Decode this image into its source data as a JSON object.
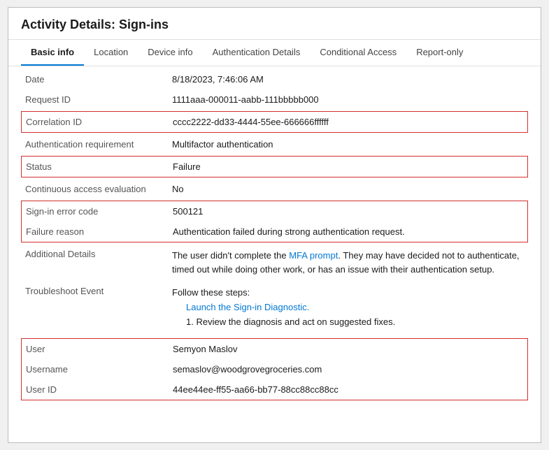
{
  "window": {
    "title": "Activity Details: Sign-ins"
  },
  "tabs": [
    {
      "label": "Basic info",
      "active": true
    },
    {
      "label": "Location",
      "active": false
    },
    {
      "label": "Device info",
      "active": false
    },
    {
      "label": "Authentication Details",
      "active": false
    },
    {
      "label": "Conditional Access",
      "active": false
    },
    {
      "label": "Report-only",
      "active": false
    }
  ],
  "rows": {
    "date_label": "Date",
    "date_value": "8/18/2023, 7:46:06 AM",
    "request_id_label": "Request ID",
    "request_id_value": "1111aaa-000011-aabb-111bbbbb000",
    "correlation_id_label": "Correlation ID",
    "correlation_id_value": "cccc2222-dd33-4444-55ee-666666ffffff",
    "auth_req_label": "Authentication requirement",
    "auth_req_value": "Multifactor authentication",
    "status_label": "Status",
    "status_value": "Failure",
    "continuous_eval_label": "Continuous access evaluation",
    "continuous_eval_value": "No",
    "sign_in_error_label": "Sign-in error code",
    "sign_in_error_value": "500121",
    "failure_reason_label": "Failure reason",
    "failure_reason_value": "Authentication failed during strong authentication request.",
    "additional_details_label": "Additional Details",
    "additional_details_value_1": "The user didn't complete the ",
    "additional_details_highlight": "MFA prompt",
    "additional_details_value_2": ". They may have decided not to authenticate, timed out while doing other work, or has an issue with their authentication setup.",
    "troubleshoot_label": "Troubleshoot Event",
    "troubleshoot_follow": "Follow these steps:",
    "troubleshoot_link": "Launch the Sign-in Diagnostic.",
    "troubleshoot_step": "1. Review the diagnosis and act on suggested fixes.",
    "user_label": "User",
    "user_value": "Semyon Maslov",
    "username_label": "Username",
    "username_value": "semaslov@woodgrovegroceries.com",
    "user_id_label": "User ID",
    "user_id_value": "44ee44ee-ff55-aa66-bb77-88cc88cc88cc"
  }
}
